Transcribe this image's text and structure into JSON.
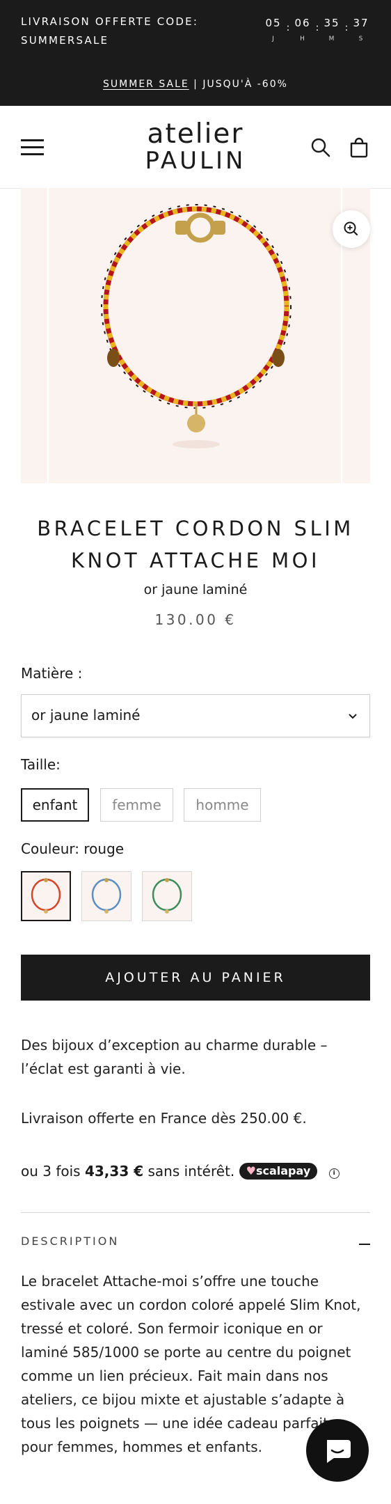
{
  "announcement": {
    "promo_text": "LIVRAISON OFFERTE CODE: SUMMERSALE",
    "countdown": [
      {
        "value": "05",
        "unit": "J"
      },
      {
        "value": "06",
        "unit": "H"
      },
      {
        "value": "35",
        "unit": "M"
      },
      {
        "value": "37",
        "unit": "S"
      }
    ],
    "sale_link": "SUMMER SALE",
    "sale_rest": " | JUSQU'À -60%"
  },
  "header": {
    "logo_line1": "atelier",
    "logo_line2": "PAULIN",
    "icons": [
      "menu-icon",
      "search-icon",
      "bag-icon"
    ]
  },
  "product": {
    "title": "BRACELET CORDON SLIM KNOT ATTACHE MOI",
    "subtitle": "or jaune laminé",
    "price": "130.00 €",
    "material_label": "Matière :",
    "material_value": "or jaune laminé",
    "size_label": "Taille:",
    "sizes": [
      "enfant",
      "femme",
      "homme"
    ],
    "selected_size": "enfant",
    "color_label": "Couleur: rouge",
    "swatch_colors": [
      "#d4452a",
      "#5c8ec4",
      "#3d8c5a"
    ],
    "add_to_cart": "AJOUTER AU PANIER"
  },
  "info": {
    "guarantee": "Des bijoux d’exception au charme durable – l’éclat est garanti à vie.",
    "shipping": "Livraison offerte en France dès 250.00 €.",
    "installment_prefix": "ou 3 fois ",
    "installment_amount": "43,33 €",
    "installment_suffix": " sans intérêt.",
    "scalapay_label": "scalapay"
  },
  "description": {
    "heading": "DESCRIPTION",
    "body": "Le bracelet Attache-moi s’offre une touche estivale avec un cordon coloré appelé Slim Knot, tressé et coloré. Son fermoir iconique en or laminé 585/1000 se porte au centre du poignet comme un lien précieux. Fait main dans nos ateliers, ce bijou mixte et ajustable s’adapte à tous les poignets — une idée cadeau parfaite pour femmes, hommes et enfants."
  },
  "colors": {
    "dark": "#1b1b1b",
    "gallery_bg": "#fbf3ef",
    "scalapay_pink": "#ffb5c8"
  }
}
